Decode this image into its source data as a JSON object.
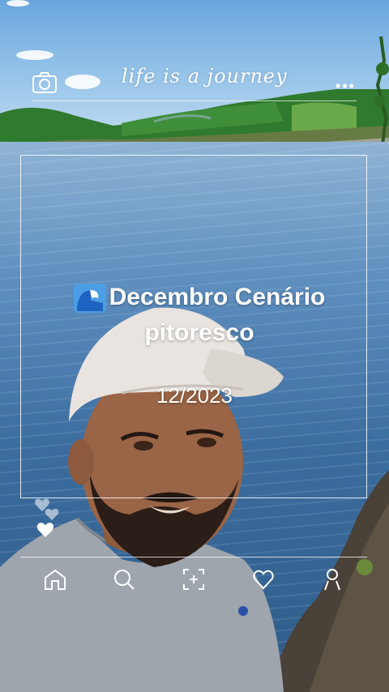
{
  "overlay": {
    "tagline": "life is a journey",
    "caption_line1": "Decembro Cenário",
    "caption_line2": "pitoresco",
    "date": "12/2023"
  },
  "icons": {
    "top_left": "camera-icon",
    "top_right": "more-dots-icon",
    "caption_emoji": "wave-emoji",
    "side": "hearts-icon",
    "nav": [
      "home-icon",
      "search-icon",
      "scan-icon",
      "heart-icon",
      "profile-icon"
    ]
  },
  "colors": {
    "overlay_text": "#ffffff",
    "sky": "#6aa6de",
    "river": "#3c6d9f",
    "vegetation": "#2f7a2e"
  }
}
